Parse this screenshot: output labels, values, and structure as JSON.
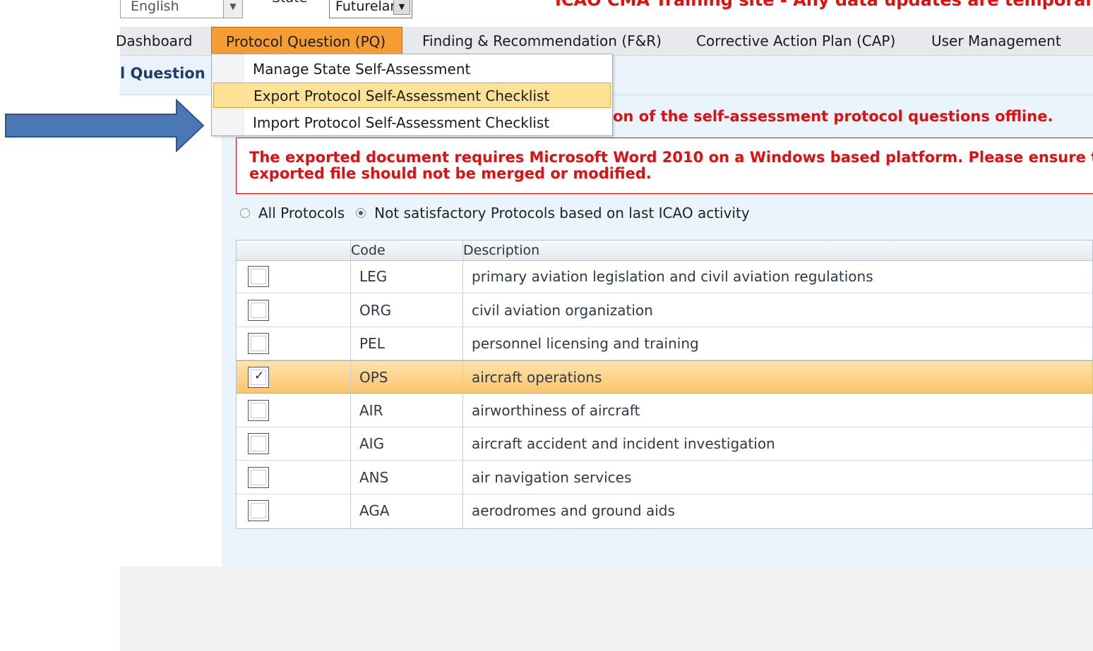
{
  "top": {
    "language": "English",
    "state_label": "State",
    "state_value": "Futureland",
    "banner": "ICAO CMA Training site - Any data updates are temporal"
  },
  "nav": {
    "items": [
      {
        "label": "Dashboard"
      },
      {
        "label": "Protocol Question (PQ)"
      },
      {
        "label": "Finding & Recommendation (F&R)"
      },
      {
        "label": "Corrective Action Plan (CAP)"
      },
      {
        "label": "User Management"
      }
    ]
  },
  "page": {
    "title": "l Question (",
    "info": "on of the self-assessment protocol questions offline.",
    "warning_line1": "The exported document requires Microsoft Word 2010 on a Windows based platform. Please ensure the",
    "warning_line2": "exported file should not be merged or modified."
  },
  "filter": {
    "option_all": "All Protocols",
    "option_not_sat": "Not satisfactory Protocols based on last ICAO activity",
    "selected": "not_satisfactory"
  },
  "table": {
    "headers": {
      "code": "Code",
      "description": "Description"
    },
    "rows": [
      {
        "code": "LEG",
        "description": "primary aviation legislation and civil aviation regulations",
        "checked": false
      },
      {
        "code": "ORG",
        "description": "civil aviation organization",
        "checked": false
      },
      {
        "code": "PEL",
        "description": "personnel licensing and training",
        "checked": false
      },
      {
        "code": "OPS",
        "description": "aircraft operations",
        "checked": true
      },
      {
        "code": "AIR",
        "description": "airworthiness of aircraft",
        "checked": false
      },
      {
        "code": "AIG",
        "description": "aircraft accident and incident investigation",
        "checked": false
      },
      {
        "code": "ANS",
        "description": "air navigation services",
        "checked": false
      },
      {
        "code": "AGA",
        "description": "aerodromes and ground aids",
        "checked": false
      }
    ]
  },
  "menu": {
    "items": [
      {
        "label": "Manage State Self-Assessment"
      },
      {
        "label": "Export Protocol Self-Assessment Checklist"
      },
      {
        "label": "Import Protocol Self-Assessment Checklist"
      }
    ]
  },
  "colors": {
    "active_tab": "#f59c33",
    "warning_red": "#e01010",
    "arrow_blue": "#4a78b5",
    "selected_row": "#fbc56c"
  }
}
